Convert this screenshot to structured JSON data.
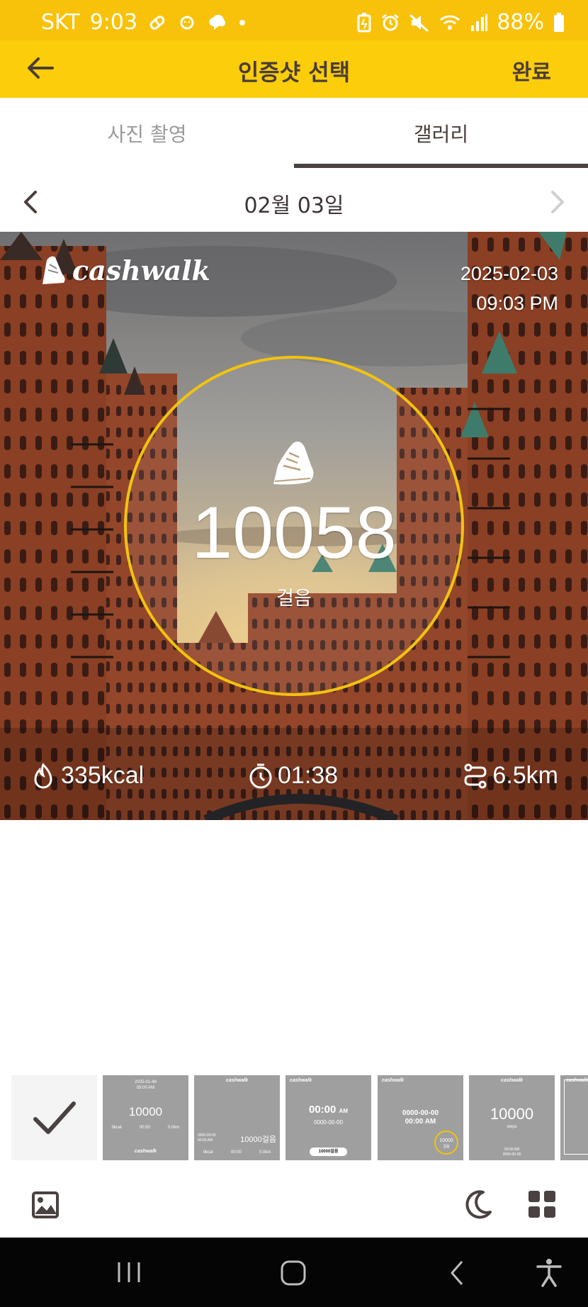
{
  "status_bar": {
    "carrier": "SKT",
    "time": "9:03",
    "battery": "88%",
    "icons": [
      "pill-icon",
      "sun-face-icon",
      "chat-cloud-icon",
      "dot-icon",
      "battery-saver-icon",
      "alarm-icon",
      "mute-icon",
      "wifi-icon",
      "signal-icon",
      "battery-icon"
    ]
  },
  "app_bar": {
    "title": "인증샷 선택",
    "done_label": "완료",
    "back_icon": "arrow-left-icon"
  },
  "tabs": [
    {
      "label": "사진 촬영",
      "active": false
    },
    {
      "label": "갤러리",
      "active": true
    }
  ],
  "date_nav": {
    "label": "02월 03일",
    "prev_icon": "chevron-left-icon",
    "next_icon": "chevron-right-icon"
  },
  "photo": {
    "brand": "cashwalk",
    "date": "2025-02-03",
    "time": "09:03 PM",
    "steps": "10058",
    "steps_label": "걸음",
    "kcal": "335kcal",
    "duration": "01:38",
    "distance": "6.5km",
    "ring_color": "#f2c30f"
  },
  "filmstrip": {
    "thumbs": [
      {
        "type": "selected"
      },
      {
        "type": "template",
        "date": "2025-01-48",
        "time": "09:00 AM",
        "steps": "10000",
        "kcal": "0kcal",
        "dur": "00:00",
        "dist": "0.0km",
        "brand": "cashwalk"
      },
      {
        "type": "template",
        "brand": "cashwalk",
        "date": "0000-00-00",
        "time": "00:00 AM",
        "steps": "10000걸음",
        "kcal": "0kcal",
        "dur": "00:00",
        "dist": "0.0km"
      },
      {
        "type": "template",
        "brand": "cashwalk",
        "clock": "00:00",
        "ampm": "AM",
        "date": "0000-00-00",
        "pill": "10000걸음"
      },
      {
        "type": "template",
        "brand": "cashwalk",
        "date": "0000-00-00",
        "time": "00:00 AM",
        "badge_steps": "10000",
        "badge_label": "걸음"
      },
      {
        "type": "template",
        "brand": "cashwalk",
        "steps": "10000",
        "unit": "steps",
        "time": "00:00 AM",
        "date": "0000-00-00"
      },
      {
        "type": "template",
        "brand": "cashwalk"
      }
    ]
  },
  "toolbar": {
    "gallery_icon": "image-icon",
    "night_icon": "moon-icon",
    "grid_icon": "grid-icon"
  },
  "nav_bar": {
    "icons": [
      "recent-apps-icon",
      "home-icon",
      "back-icon",
      "accessibility-icon"
    ]
  },
  "colors": {
    "status_bar": "#f9c20a",
    "app_bar": "#fccd0a",
    "tab_indicator": "#4a4141",
    "text_dark": "#4a3d3a"
  }
}
